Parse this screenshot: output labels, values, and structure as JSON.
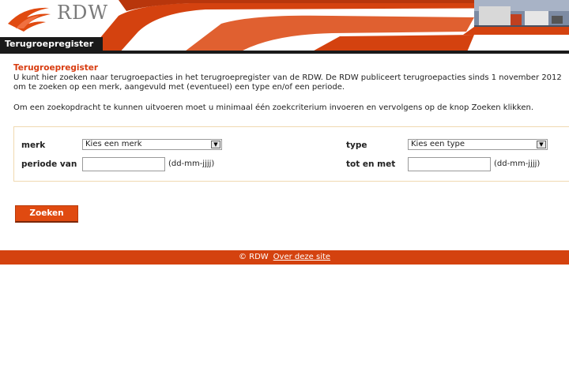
{
  "header": {
    "logo_text": "RDW",
    "page_title": "Terugroepregister"
  },
  "main": {
    "section_title": "Terugroepregister",
    "intro_line1": "U kunt hier zoeken naar terugroepacties in het terugroepregister van de RDW. De RDW publiceert terugroepacties sinds 1 november 2012",
    "intro_line2": "om te zoeken op een merk, aangevuld met (eventueel) een type en/of een periode.",
    "intro_line3": "Om een zoekopdracht te kunnen uitvoeren moet u minimaal één zoekcriterium invoeren en vervolgens op de knop Zoeken klikken."
  },
  "form": {
    "merk_label": "merk",
    "merk_selected": "Kies een merk",
    "type_label": "type",
    "type_selected": "Kies een type",
    "periode_label": "periode van",
    "periode_value": "",
    "periode_hint": "(dd-mm-jjjj)",
    "tot_label": "tot en met",
    "tot_value": "",
    "tot_hint": "(dd-mm-jjjj)",
    "search_button": "Zoeken"
  },
  "footer": {
    "copyright": "© RDW",
    "about_link": "Over deze site"
  },
  "colors": {
    "brand_orange": "#d4420f",
    "title_orange": "#d83c10",
    "title_bar": "#1a1a1a"
  }
}
